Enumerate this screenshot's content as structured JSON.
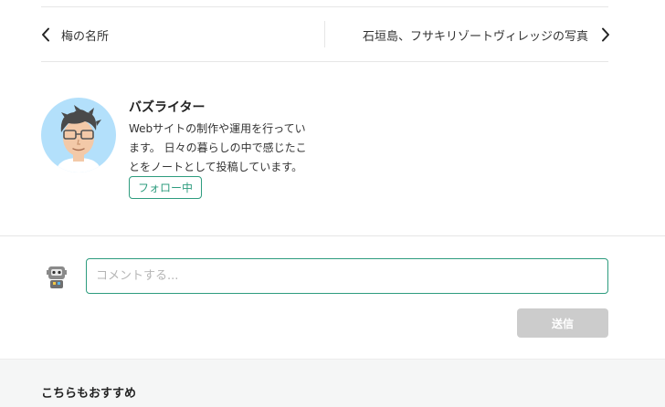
{
  "pager": {
    "prev_label": "梅の名所",
    "next_label": "石垣島、フサキリゾートヴィレッジの写真"
  },
  "author": {
    "name": "バズライター",
    "bio": "Webサイトの制作や運用を行っています。 日々の暮らしの中で感じたことをノートとして投稿しています。",
    "follow_label": "フォロー中"
  },
  "comment": {
    "placeholder": "コメントする...",
    "send_label": "送信"
  },
  "recommend": {
    "title": "こちらもおすすめ"
  },
  "colors": {
    "accent": "#2d9c7e",
    "disabled": "#cccccc",
    "avatar_bg": "#b3e0fb"
  }
}
